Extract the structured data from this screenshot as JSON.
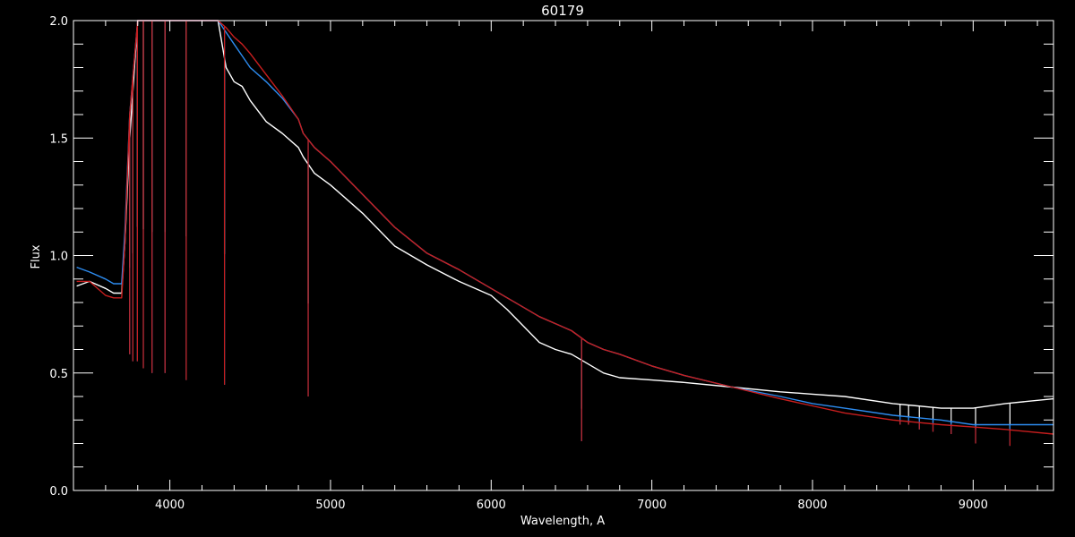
{
  "chart_data": {
    "type": "line",
    "title": "60179",
    "xlabel": "Wavelength, A",
    "ylabel": "Flux",
    "xlim": [
      3400,
      9500
    ],
    "ylim": [
      0.0,
      2.0
    ],
    "x_ticks": [
      4000,
      5000,
      6000,
      7000,
      8000,
      9000
    ],
    "x_tick_labels": [
      "4000",
      "5000",
      "6000",
      "7000",
      "8000",
      "9000"
    ],
    "y_ticks": [
      0.0,
      0.5,
      1.0,
      1.5,
      2.0
    ],
    "y_tick_labels": [
      "0.0",
      "0.5",
      "1.0",
      "1.5",
      "2.0"
    ],
    "x_minor_step": 200,
    "y_minor_step": 0.1,
    "grid": false,
    "colors": {
      "background": "#000000",
      "axes": "#ffffff"
    },
    "series": [
      {
        "color": "#ffffff",
        "x": [
          3420,
          3500,
          3600,
          3650,
          3700,
          3720,
          3750,
          3800,
          3850,
          3900,
          3950,
          4000,
          4050,
          4150,
          4200,
          4250,
          4300,
          4350,
          4400,
          4450,
          4500,
          4600,
          4700,
          4800,
          4830,
          4900,
          5000,
          5200,
          5400,
          5600,
          5800,
          6000,
          6100,
          6200,
          6300,
          6400,
          6500,
          6600,
          6700,
          6800,
          7000,
          7200,
          7500,
          7800,
          8000,
          8200,
          8500,
          8800,
          9000,
          9200,
          9500
        ],
        "y": [
          0.87,
          0.89,
          0.86,
          0.84,
          0.84,
          1.05,
          1.5,
          2.0,
          2.0,
          2.0,
          2.0,
          2.0,
          2.0,
          2.0,
          2.0,
          2.0,
          2.0,
          1.8,
          1.74,
          1.72,
          1.66,
          1.57,
          1.52,
          1.46,
          1.42,
          1.35,
          1.3,
          1.18,
          1.04,
          0.96,
          0.89,
          0.83,
          0.77,
          0.7,
          0.63,
          0.6,
          0.58,
          0.54,
          0.5,
          0.48,
          0.47,
          0.46,
          0.44,
          0.42,
          0.41,
          0.4,
          0.37,
          0.35,
          0.35,
          0.37,
          0.39
        ]
      },
      {
        "color": "#2d8cf0",
        "x": [
          3420,
          3500,
          3600,
          3650,
          3700,
          3720,
          3750,
          3800,
          3850,
          3900,
          3950,
          4000,
          4050,
          4150,
          4200,
          4250,
          4300,
          4350,
          4400,
          4450,
          4500,
          4600,
          4700,
          4800,
          4830,
          4900,
          5000,
          5200,
          5400,
          5600,
          5800,
          6000,
          6100,
          6200,
          6300,
          6400,
          6500,
          6600,
          6700,
          6800,
          7000,
          7200,
          7500,
          7800,
          8000,
          8200,
          8500,
          8800,
          9000,
          9200,
          9500
        ],
        "y": [
          0.95,
          0.93,
          0.9,
          0.88,
          0.88,
          1.1,
          1.6,
          2.0,
          2.0,
          2.0,
          2.0,
          2.0,
          2.0,
          2.0,
          2.0,
          2.0,
          2.0,
          1.95,
          1.9,
          1.85,
          1.8,
          1.74,
          1.67,
          1.58,
          1.52,
          1.46,
          1.4,
          1.26,
          1.12,
          1.01,
          0.94,
          0.86,
          0.82,
          0.78,
          0.74,
          0.71,
          0.68,
          0.63,
          0.6,
          0.58,
          0.53,
          0.49,
          0.44,
          0.4,
          0.37,
          0.35,
          0.32,
          0.3,
          0.28,
          0.28,
          0.28
        ]
      },
      {
        "color": "#c81e1e",
        "x": [
          3420,
          3500,
          3600,
          3650,
          3700,
          3720,
          3750,
          3800,
          3850,
          3900,
          3950,
          4000,
          4050,
          4150,
          4200,
          4250,
          4300,
          4350,
          4400,
          4450,
          4500,
          4600,
          4700,
          4800,
          4830,
          4900,
          5000,
          5200,
          5400,
          5600,
          5800,
          6000,
          6100,
          6200,
          6300,
          6400,
          6500,
          6600,
          6700,
          6800,
          7000,
          7200,
          7500,
          7800,
          8000,
          8200,
          8500,
          8800,
          9000,
          9200,
          9500
        ],
        "y": [
          0.89,
          0.89,
          0.83,
          0.82,
          0.82,
          1.05,
          1.6,
          2.0,
          2.0,
          2.0,
          2.0,
          2.0,
          2.0,
          2.0,
          2.0,
          2.0,
          2.0,
          1.97,
          1.93,
          1.9,
          1.86,
          1.77,
          1.68,
          1.58,
          1.52,
          1.46,
          1.4,
          1.26,
          1.12,
          1.01,
          0.94,
          0.86,
          0.82,
          0.78,
          0.74,
          0.71,
          0.68,
          0.63,
          0.6,
          0.58,
          0.53,
          0.49,
          0.44,
          0.39,
          0.36,
          0.33,
          0.3,
          0.28,
          0.27,
          0.26,
          0.24
        ]
      }
    ],
    "absorption_lines": [
      {
        "x": 3750,
        "y": 0.58
      },
      {
        "x": 3770,
        "y": 0.55
      },
      {
        "x": 3798,
        "y": 0.55
      },
      {
        "x": 3835,
        "y": 0.52
      },
      {
        "x": 3889,
        "y": 0.5
      },
      {
        "x": 3970,
        "y": 0.5
      },
      {
        "x": 4102,
        "y": 0.47
      },
      {
        "x": 4340,
        "y": 0.45
      },
      {
        "x": 4861,
        "y": 0.4
      },
      {
        "x": 6563,
        "y": 0.21
      },
      {
        "x": 8545,
        "y": 0.28
      },
      {
        "x": 8598,
        "y": 0.28
      },
      {
        "x": 8665,
        "y": 0.26
      },
      {
        "x": 8750,
        "y": 0.25
      },
      {
        "x": 8863,
        "y": 0.24
      },
      {
        "x": 9015,
        "y": 0.2
      },
      {
        "x": 9229,
        "y": 0.19
      }
    ]
  }
}
